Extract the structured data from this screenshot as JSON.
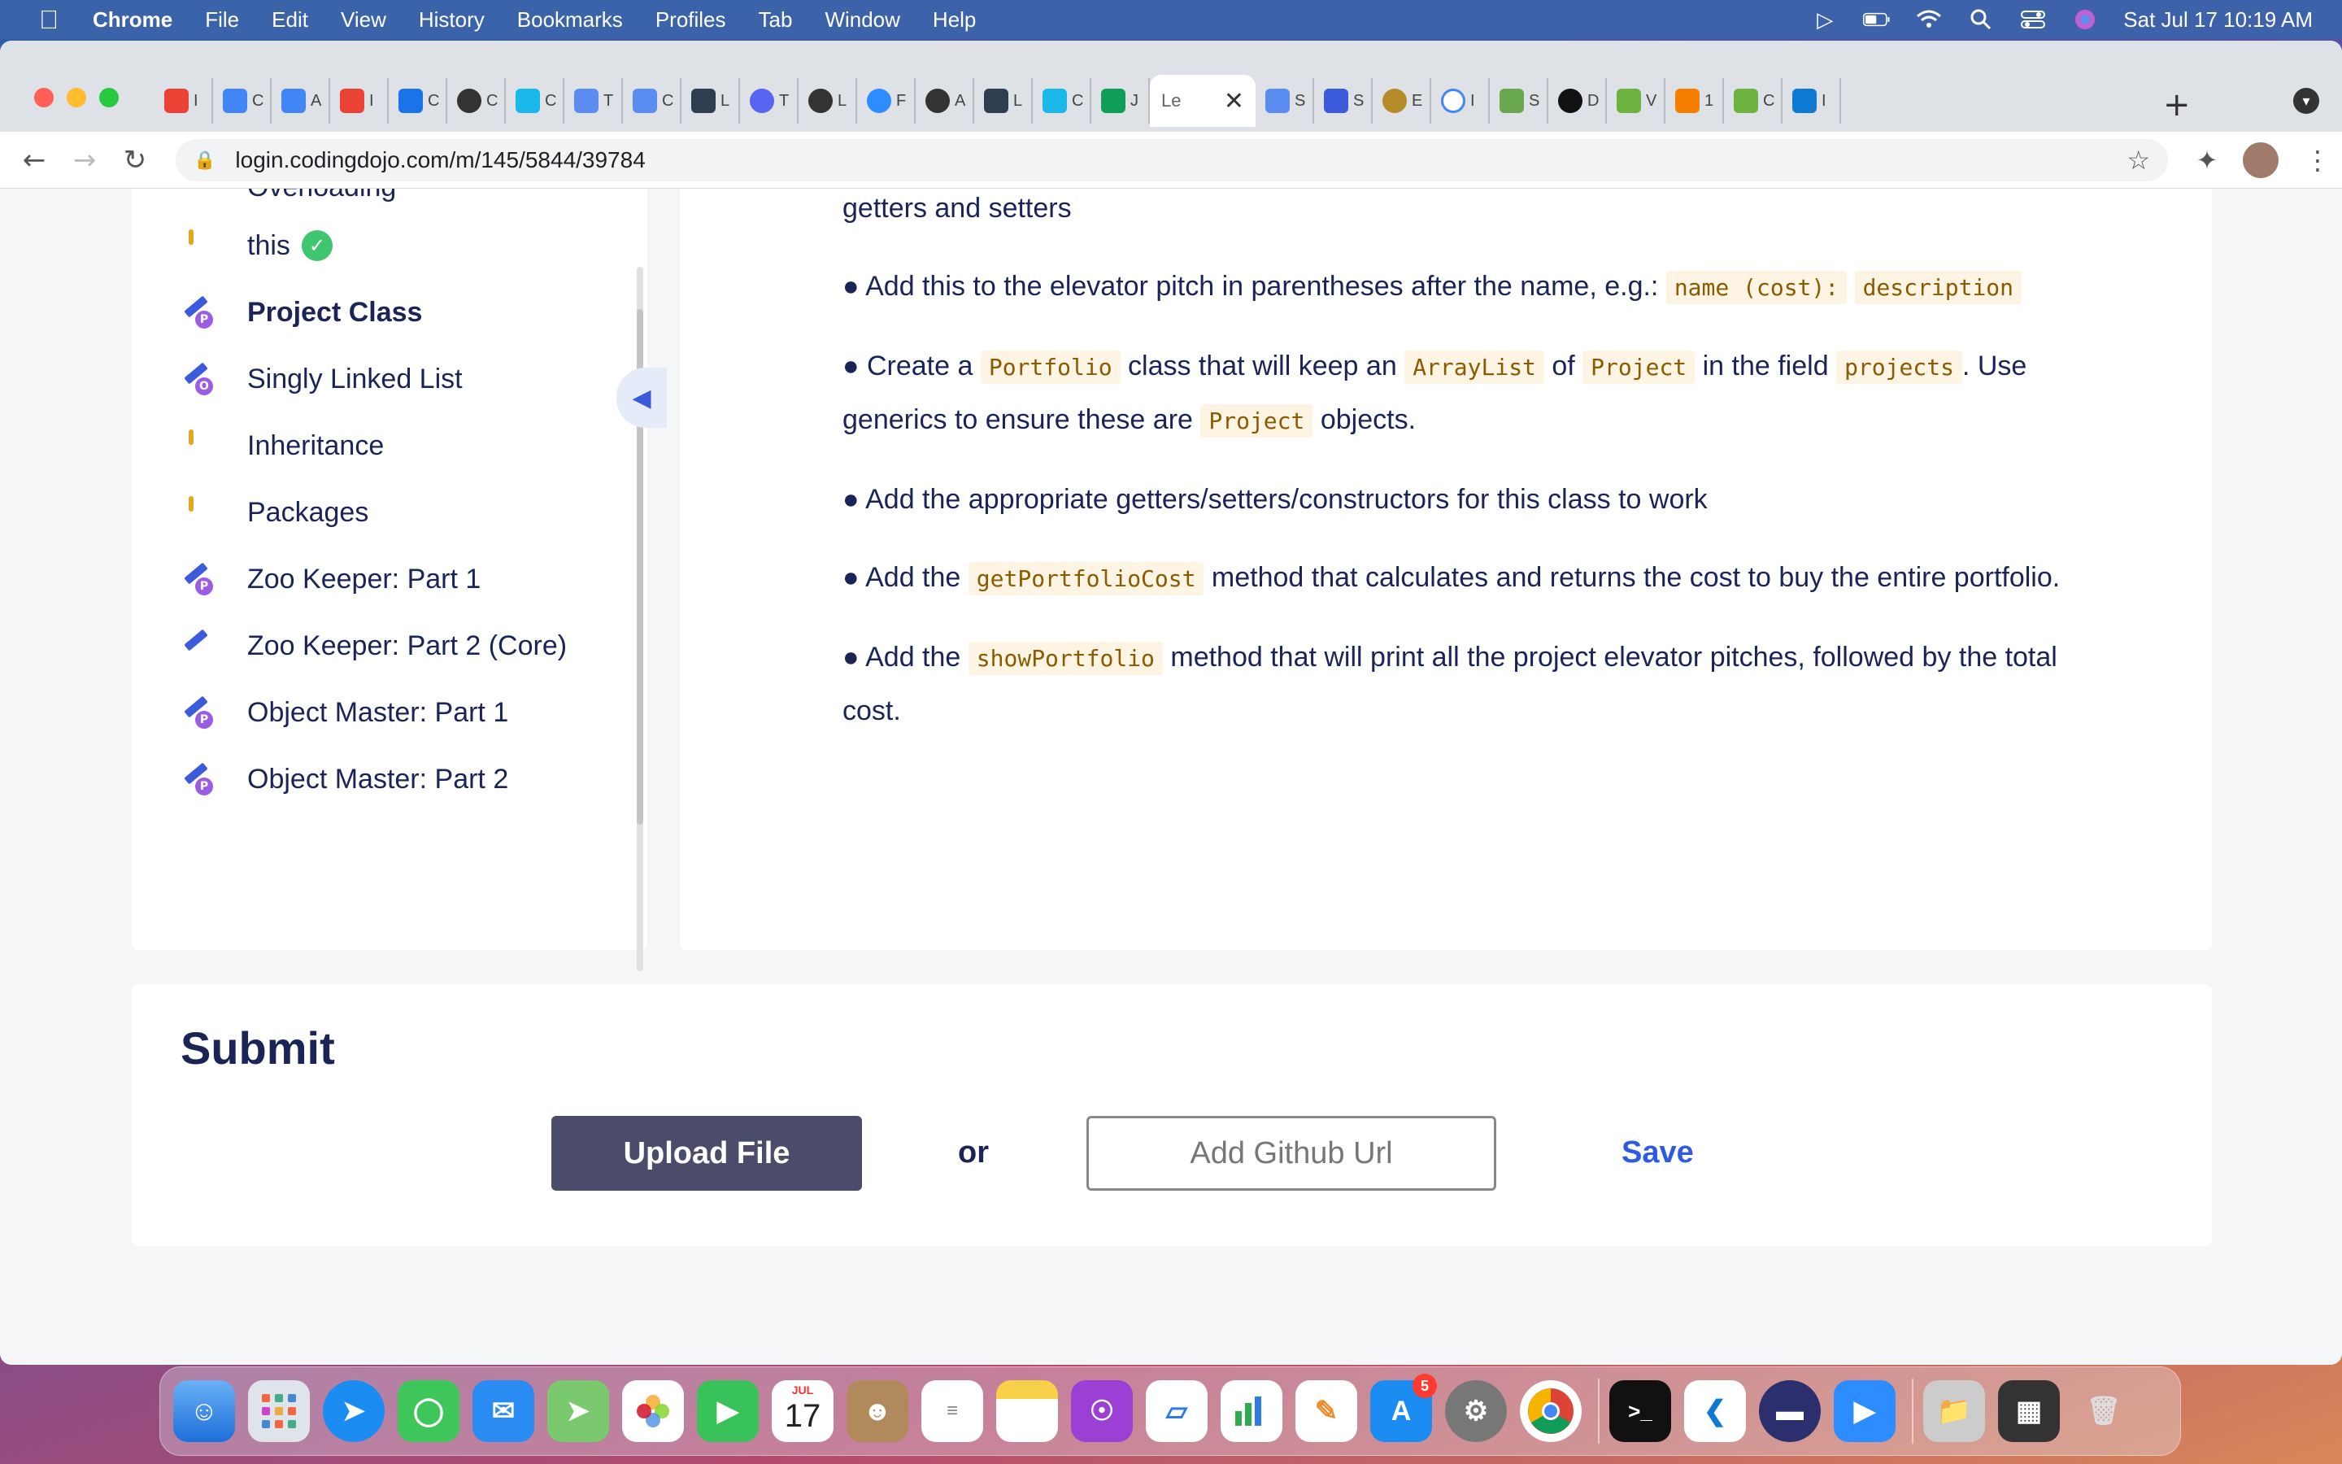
{
  "menubar": {
    "app": "Chrome",
    "items": [
      "File",
      "Edit",
      "View",
      "History",
      "Bookmarks",
      "Profiles",
      "Tab",
      "Window",
      "Help"
    ],
    "clock": "Sat Jul 17  10:19 AM"
  },
  "browser": {
    "active_tab_label": "Le",
    "tab_letters": [
      "I",
      "C",
      "A",
      "I",
      "C",
      "C",
      "C",
      "T",
      "C",
      "L",
      "T",
      "L",
      "F",
      "A",
      "L",
      "C",
      "J",
      "S",
      "S",
      "E",
      "I",
      "S",
      "D",
      "V",
      "1",
      "C",
      "I"
    ],
    "url": "login.codingdojo.com/m/145/5844/39784"
  },
  "sidebar": {
    "items": [
      {
        "label": "Overloading",
        "icon": "book-icon"
      },
      {
        "label": "this",
        "icon": "book-icon",
        "completed": true
      },
      {
        "label": "Project Class",
        "icon": "assignment-icon",
        "active": true
      },
      {
        "label": "Singly Linked List",
        "icon": "assignment-optional-icon"
      },
      {
        "label": "Inheritance",
        "icon": "book-icon"
      },
      {
        "label": "Packages",
        "icon": "book-icon"
      },
      {
        "label": "Zoo Keeper: Part 1",
        "icon": "assignment-icon"
      },
      {
        "label": "Zoo Keeper: Part 2 (Core)",
        "icon": "pencil-icon"
      },
      {
        "label": "Object Master: Part 1",
        "icon": "assignment-icon"
      },
      {
        "label": "Object Master: Part 2",
        "icon": "assignment-icon"
      }
    ]
  },
  "content": {
    "line0": "getters and setters",
    "b1_pre": "Add this to the elevator pitch in parentheses after the name, e.g.: ",
    "b1_code1": "name (cost):",
    "b1_code2": "description",
    "b2_pre": "Create a ",
    "b2_code1": "Portfolio",
    "b2_mid1": " class that will keep an ",
    "b2_code2": "ArrayList",
    "b2_mid2": " of ",
    "b2_code3": "Project",
    "b2_mid3": " in the field ",
    "b2_code4": "projects",
    "b2_mid4": ". Use generics to ensure these are ",
    "b2_code5": "Project",
    "b2_end": " objects.",
    "b3": "Add the appropriate getters/setters/constructors for this class to work",
    "b4_pre": "Add the ",
    "b4_code": "getPortfolioCost",
    "b4_end": " method that calculates and returns the cost to buy the entire portfolio.",
    "b5_pre": "Add the ",
    "b5_code": "showPortfolio",
    "b5_end": " method that will print all the project elevator pitches, followed by the total cost."
  },
  "submit": {
    "title": "Submit",
    "upload_label": "Upload File",
    "or_label": "or",
    "github_placeholder": "Add Github Url",
    "save_label": "Save"
  },
  "dock": {
    "calendar_month": "JUL",
    "calendar_day": "17",
    "appstore_badge": "5"
  },
  "colors": {
    "navy": "#1b2456",
    "accent_blue": "#2e5be4",
    "upload_bg": "#4a4c6a",
    "check_green": "#3fc66f"
  }
}
